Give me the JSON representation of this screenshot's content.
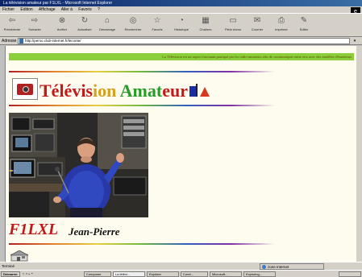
{
  "window": {
    "title": "La télévision amateur par F1LXL - Microsoft Internet Explorer",
    "brand_mark": "e"
  },
  "menu": [
    "Fichier",
    "Edition",
    "Affichage",
    "Aller à",
    "Favoris",
    "?"
  ],
  "toolbar": [
    {
      "label": "Précédente",
      "icon": "back-arrow-icon"
    },
    {
      "label": "Suivante",
      "icon": "forward-arrow-icon"
    },
    {
      "label": "Arrêter",
      "icon": "stop-icon"
    },
    {
      "label": "Actualiser",
      "icon": "refresh-icon"
    },
    {
      "label": "Démarrage",
      "icon": "home-icon"
    },
    {
      "label": "Rechercher",
      "icon": "search-icon"
    },
    {
      "label": "Favoris",
      "icon": "favorites-icon"
    },
    {
      "label": "Historique",
      "icon": "history-icon"
    },
    {
      "label": "Chaînes",
      "icon": "channels-icon"
    },
    {
      "label": "Plein écran",
      "icon": "fullscreen-icon"
    },
    {
      "label": "Courrier",
      "icon": "mail-icon"
    },
    {
      "label": "Imprimer",
      "icon": "print-icon"
    },
    {
      "label": "Editer",
      "icon": "edit-icon"
    }
  ],
  "address": {
    "label": "Adresse",
    "value": "http://perso.club-internet.fr/leconte/"
  },
  "page": {
    "banner": "La Télévision est un aspect fascinant pratiqué par les radio-amateurs afin de communiquer entre eux avec des modèles d'émetteurs",
    "title_part1": "Télévis",
    "title_part2": "ion ",
    "title_part3": "Amat",
    "title_part4": "eur",
    "callsign": "F1LXL",
    "operator_name": "Jean-Pierre"
  },
  "status": {
    "left": "Terminé",
    "zone": "zone Internet"
  },
  "taskbar": {
    "start": "Démarrer",
    "tasks": [
      "Composer",
      "La télévi...",
      "Explorer",
      "Corel...",
      "Microsoft...",
      "Exploring..."
    ],
    "clock": ""
  },
  "colors": {
    "page_bg": "#fdfcee",
    "banner_bg": "#8bcd3a",
    "title_red": "#c21a1a",
    "title_green": "#2a9a2a",
    "title_yellow": "#d4a020",
    "callsign_red": "#c01a1a"
  }
}
